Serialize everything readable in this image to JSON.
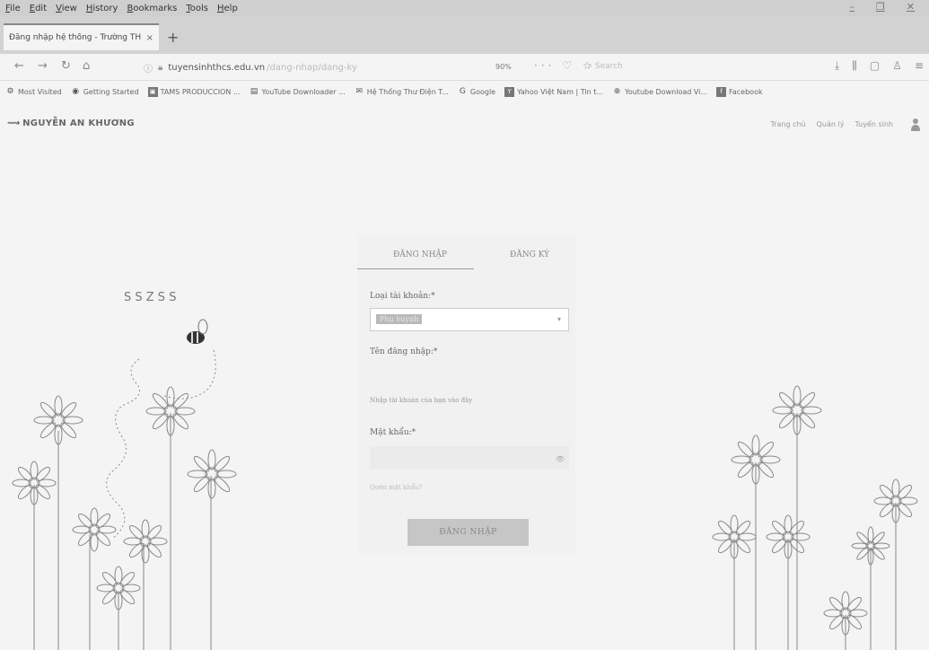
{
  "browser": {
    "menu": [
      "File",
      "Edit",
      "View",
      "History",
      "Bookmarks",
      "Tools",
      "Help"
    ],
    "tab_title": "Đăng nhập hệ thống - Trường TH",
    "tab_close": "×",
    "new_tab": "+",
    "url": "tuyensinhthcs.edu.vn",
    "url_path": "/dang-nhap/dang-ky",
    "zoom": "90%",
    "search_placeholder": "Search",
    "bookmarks": [
      {
        "label": "Most Visited",
        "icon": "gear-icon"
      },
      {
        "label": "Getting Started",
        "icon": "firefox-icon"
      },
      {
        "label": "TAMS PRODUCCION ...",
        "icon": "page-icon"
      },
      {
        "label": "YouTube Downloader ...",
        "icon": "page-icon"
      },
      {
        "label": "Hệ Thống Thư Điện T...",
        "icon": "mail-icon"
      },
      {
        "label": "Google",
        "icon": "google-icon"
      },
      {
        "label": "Yahoo Việt Nam | Tin t...",
        "icon": "yahoo-icon"
      },
      {
        "label": "Youtube Download Vi...",
        "icon": "globe-icon"
      },
      {
        "label": "Facebook",
        "icon": "facebook-icon"
      }
    ]
  },
  "site": {
    "logo": "NGUYỄN AN KHƯƠNG",
    "nav": [
      "Trang chủ",
      "Quản lý",
      "Tuyển sinh"
    ]
  },
  "login": {
    "tab_login": "ĐĂNG NHẬP",
    "tab_register": "ĐĂNG KÝ",
    "account_type_label": "Loại tài khoản:*",
    "account_type_value": "Phụ huynh",
    "username_label": "Tên đăng nhập:*",
    "username_placeholder": "Nhập tài khoản của bạn vào đây",
    "password_label": "Mật khẩu:*",
    "forgot_link": "Quên mật khẩu?",
    "submit_label": "ĐĂNG NHẬP"
  }
}
